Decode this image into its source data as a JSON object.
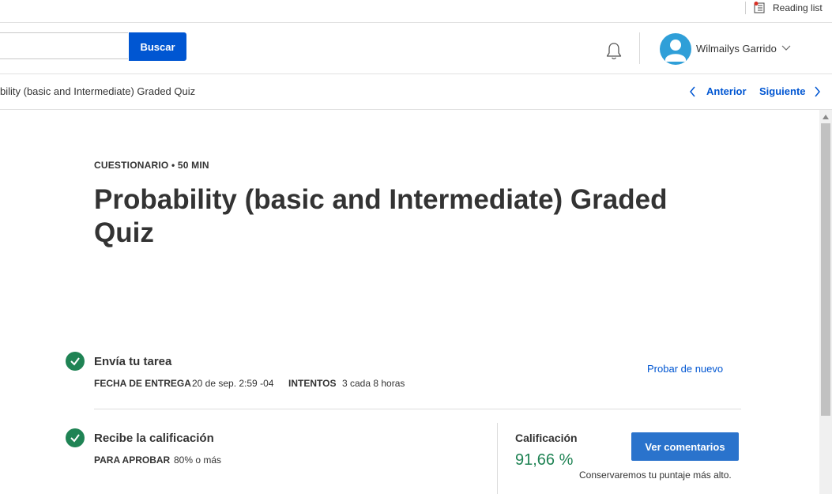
{
  "browser": {
    "reading_list": "Reading list"
  },
  "header": {
    "search_placeholder": "",
    "search_button": "Buscar",
    "user_name": "Wilmailys Garrido"
  },
  "breadcrumb": {
    "item_title": "bility (basic and Intermediate) Graded Quiz",
    "prev": "Anterior",
    "next": "Siguiente"
  },
  "quiz": {
    "meta": "CUESTIONARIO • 50 MIN",
    "title": "Probability (basic and Intermediate) Graded Quiz"
  },
  "steps": [
    {
      "title": "Envía tu tarea",
      "fields": [
        {
          "label": "FECHA DE ENTREGA",
          "value": "20 de sep. 2:59 -04"
        },
        {
          "label": "INTENTOS",
          "value": "3 cada 8 horas"
        }
      ],
      "action": "Probar de nuevo"
    },
    {
      "title": "Recibe la calificación",
      "fields": [
        {
          "label": "PARA APROBAR",
          "value": "80% o más"
        }
      ]
    }
  ],
  "grade": {
    "label": "Calificación",
    "value": "91,66 %",
    "button": "Ver comentarios",
    "note": "Conservaremos tu puntaje más alto."
  },
  "colors": {
    "primary": "#0056d2",
    "success": "#1f8354",
    "button": "#2a73cc",
    "avatar": "#2f9fd8"
  }
}
